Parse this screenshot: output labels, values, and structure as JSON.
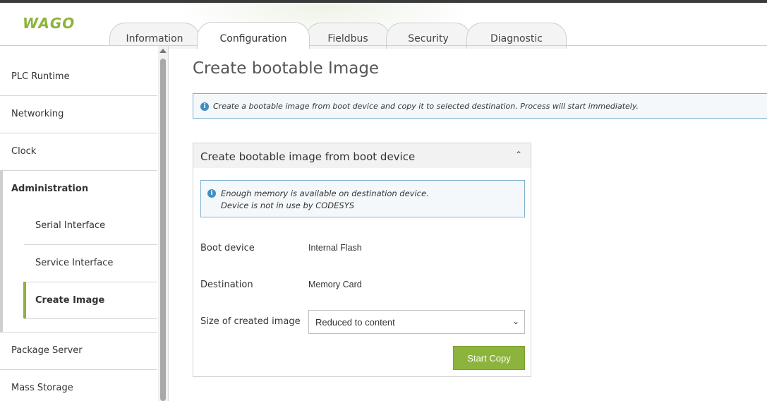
{
  "header": {
    "logo_text": "WAGO",
    "tabs": [
      {
        "label": "Information"
      },
      {
        "label": "Configuration"
      },
      {
        "label": "Fieldbus"
      },
      {
        "label": "Security"
      },
      {
        "label": "Diagnostic"
      }
    ],
    "active_tab": "Configuration"
  },
  "sidebar": {
    "items": [
      {
        "label": "PLC Runtime"
      },
      {
        "label": "Networking"
      },
      {
        "label": "Clock"
      },
      {
        "label": "Administration"
      },
      {
        "label": "Package Server"
      },
      {
        "label": "Mass Storage"
      }
    ],
    "sub_items": [
      {
        "label": "Serial Interface"
      },
      {
        "label": "Service Interface"
      },
      {
        "label": "Create Image"
      }
    ],
    "active_item": "Create Image"
  },
  "main": {
    "title": "Create bootable Image",
    "info_icon": "i",
    "info_text": "Create a bootable image from boot device and copy it to selected destination. Process will start immediately.",
    "panel": {
      "title": "Create bootable image from boot device",
      "collapse_glyph": "⌃",
      "notice_line1": "Enough memory is available on destination device.",
      "notice_line2": "Device is not in use by CODESYS",
      "boot_device_label": "Boot device",
      "boot_device_value": "Internal Flash",
      "destination_label": "Destination",
      "destination_value": "Memory Card",
      "size_label": "Size of created image",
      "size_value": "Reduced to content",
      "chevron_glyph": "⌄",
      "start_button": "Start Copy"
    }
  },
  "colors": {
    "accent": "#8cb43c",
    "info_border": "#7fb2cf",
    "info_icon": "#3f8fc3"
  }
}
